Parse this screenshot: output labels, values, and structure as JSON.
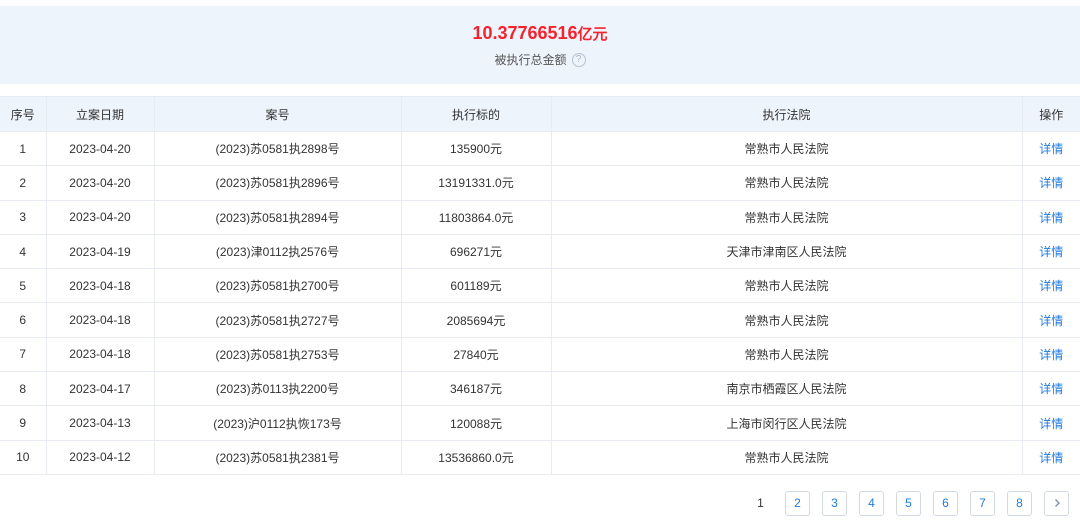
{
  "summary": {
    "amount": "10.37766516",
    "unit": "亿元",
    "label": "被执行总金额",
    "help_icon": "question-circle-icon"
  },
  "table": {
    "headers": [
      "序号",
      "立案日期",
      "案号",
      "执行标的",
      "执行法院",
      "操作"
    ],
    "rows": [
      [
        "1",
        "2023-04-20",
        "(2023)苏0581执2898号",
        "135900元",
        "常熟市人民法院",
        "详情"
      ],
      [
        "2",
        "2023-04-20",
        "(2023)苏0581执2896号",
        "13191331.0元",
        "常熟市人民法院",
        "详情"
      ],
      [
        "3",
        "2023-04-20",
        "(2023)苏0581执2894号",
        "11803864.0元",
        "常熟市人民法院",
        "详情"
      ],
      [
        "4",
        "2023-04-19",
        "(2023)津0112执2576号",
        "696271元",
        "天津市津南区人民法院",
        "详情"
      ],
      [
        "5",
        "2023-04-18",
        "(2023)苏0581执2700号",
        "601189元",
        "常熟市人民法院",
        "详情"
      ],
      [
        "6",
        "2023-04-18",
        "(2023)苏0581执2727号",
        "2085694元",
        "常熟市人民法院",
        "详情"
      ],
      [
        "7",
        "2023-04-18",
        "(2023)苏0581执2753号",
        "27840元",
        "常熟市人民法院",
        "详情"
      ],
      [
        "8",
        "2023-04-17",
        "(2023)苏0113执2200号",
        "346187元",
        "南京市栖霞区人民法院",
        "详情"
      ],
      [
        "9",
        "2023-04-13",
        "(2023)沪0112执恢173号",
        "120088元",
        "上海市闵行区人民法院",
        "详情"
      ],
      [
        "10",
        "2023-04-12",
        "(2023)苏0581执2381号",
        "13536860.0元",
        "常熟市人民法院",
        "详情"
      ]
    ]
  },
  "pagination": {
    "current": "1",
    "pages": [
      "2",
      "3",
      "4",
      "5",
      "6",
      "7",
      "8"
    ],
    "next_icon": "chevron-right-icon"
  },
  "colors": {
    "amount": "#f5222d",
    "link": "#1f7ae0",
    "header_bg": "#eef4fb"
  }
}
